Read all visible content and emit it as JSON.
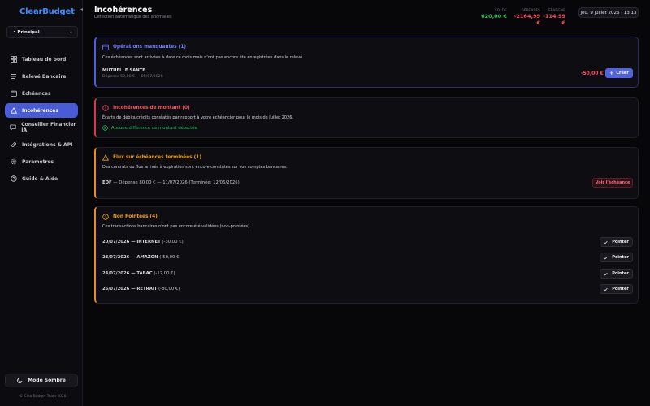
{
  "app": {
    "logo": "ClearBudget",
    "copyright": "© ClearBudget Team 2026"
  },
  "account": {
    "selected": "• Principal"
  },
  "nav": [
    {
      "label": "Tableau de bord",
      "icon": "dashboard-icon"
    },
    {
      "label": "Relevé Bancaire",
      "icon": "statement-icon"
    },
    {
      "label": "Échéances",
      "icon": "calendar-icon"
    },
    {
      "label": "Incohérences",
      "icon": "warning-icon",
      "active": true
    },
    {
      "label": "Conseiller Financier IA",
      "icon": "chat-icon"
    },
    {
      "label": "Intégrations & API",
      "icon": "integration-icon"
    },
    {
      "label": "Paramètres",
      "icon": "gear-icon"
    },
    {
      "label": "Guide & Aide",
      "icon": "help-icon"
    }
  ],
  "mode_button": "Mode Sombre",
  "header": {
    "title": "Incohérences",
    "subtitle": "Détection automatique des anomalies",
    "stats": [
      {
        "label": "SOLDE",
        "value": "620,00 €",
        "color": "#22c55e"
      },
      {
        "label": "DÉPENSES",
        "value": "-2164,99 €",
        "color": "#ff4d5e"
      },
      {
        "label": "ÉPARGNE",
        "value": "-114,99 €",
        "color": "#ff4d5e"
      }
    ],
    "date": "jeu. 9 juillet 2026 · 13:13"
  },
  "missing_ops": {
    "title": "Opérations manquantes (1)",
    "title_color": "#6d7bff",
    "description": "Ces échéances sont arrivées à date ce mois mais n'ont pas encore été enregistrées dans le relevé.",
    "item": {
      "name": "MUTUELLE SANTE",
      "detail": "Dépense 50,00 € — 05/07/2026",
      "amount": "-50,00 €",
      "button": "Créer"
    }
  },
  "amount_inconsistencies": {
    "title": "Incohérences de montant (0)",
    "title_color": "#ff4d5e",
    "description": "Écarts de débits/crédits constatés par rapport à votre échéancier pour le mois de Juillet 2026.",
    "ok_message": "Aucune différence de montant détectée"
  },
  "ended_flows": {
    "title": "Flux sur échéances terminées (1)",
    "title_color": "#f59e0b",
    "description": "Des contrats ou flux arrivés à expiration sont encore constatés sur vos comptes bancaires.",
    "item_name": "EDF",
    "item_detail": " — Dépense 80,00 € — 11/07/2026 (Terminée: 12/06/2026)",
    "button": "Voir l'échéance"
  },
  "unchecked": {
    "title": "Non Pointées (4)",
    "title_color": "#f59e0b",
    "description": "Ces transactions bancaires n'ont pas encore été validées (non-pointées).",
    "button": "Pointer",
    "rows": [
      {
        "head": "20/07/2026 — INTERNET",
        "amount": " (-30,00 €)"
      },
      {
        "head": "23/07/2026 — AMAZON",
        "amount": " (-50,00 €)"
      },
      {
        "head": "24/07/2026 — TABAC",
        "amount": " (-12,00 €)"
      },
      {
        "head": "25/07/2026 — RETRAIT",
        "amount": " (-80,00 €)"
      }
    ]
  }
}
